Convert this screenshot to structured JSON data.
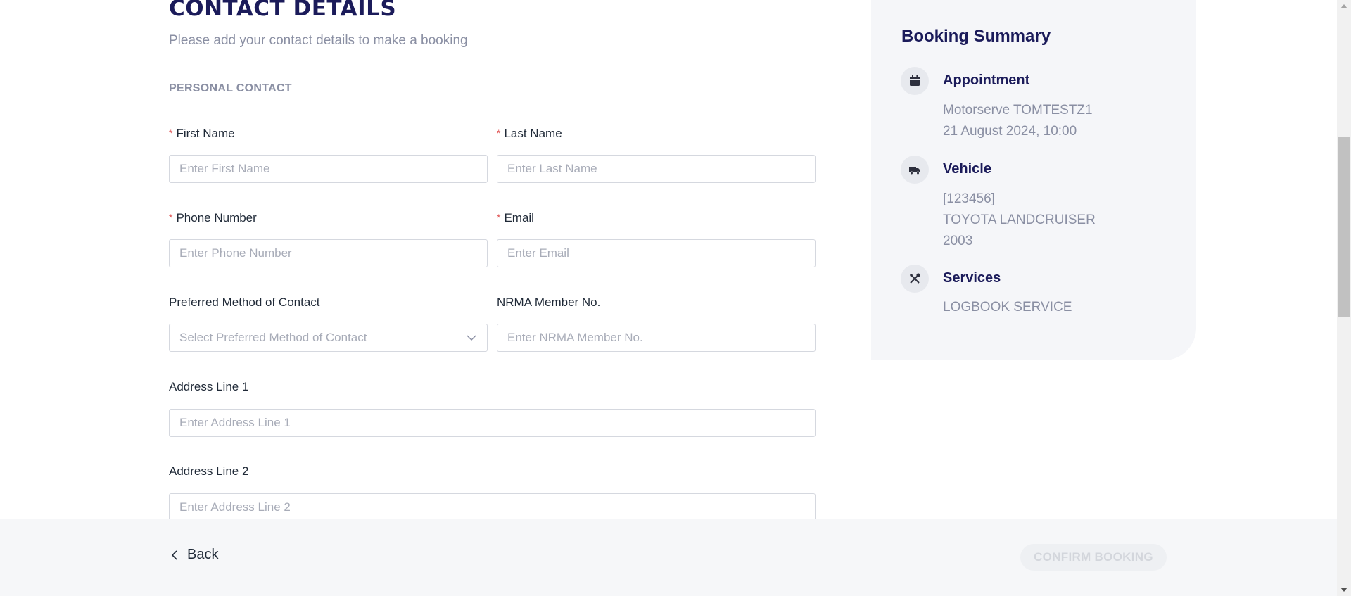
{
  "header": {
    "title": "CONTACT DETAILS",
    "subtitle": "Please add your contact details to make a booking"
  },
  "form": {
    "section_title": "PERSONAL CONTACT",
    "required_marker": "*",
    "first_name": {
      "label": "First Name",
      "placeholder": "Enter First Name",
      "value": ""
    },
    "last_name": {
      "label": "Last Name",
      "placeholder": "Enter Last Name",
      "value": ""
    },
    "phone": {
      "label": "Phone Number",
      "placeholder": "Enter Phone Number",
      "value": ""
    },
    "email": {
      "label": "Email",
      "placeholder": "Enter Email",
      "value": ""
    },
    "contact_method": {
      "label": "Preferred Method of Contact",
      "placeholder": "Select Preferred Method of Contact"
    },
    "nrma": {
      "label": "NRMA Member No.",
      "placeholder": "Enter NRMA Member No.",
      "value": ""
    },
    "address1": {
      "label": "Address Line 1",
      "placeholder": "Enter Address Line 1",
      "value": ""
    },
    "address2": {
      "label": "Address Line 2",
      "placeholder": "Enter Address Line 2",
      "value": ""
    }
  },
  "summary": {
    "title": "Booking Summary",
    "appointment": {
      "heading": "Appointment",
      "icon": "calendar-icon",
      "lines": [
        "Motorserve TOMTESTZ1",
        "21 August 2024, 10:00"
      ]
    },
    "vehicle": {
      "heading": "Vehicle",
      "icon": "truck-icon",
      "lines": [
        "[123456]",
        "TOYOTA LANDCRUISER",
        "2003"
      ]
    },
    "services": {
      "heading": "Services",
      "icon": "tools-icon",
      "lines": [
        "LOGBOOK SERVICE"
      ]
    }
  },
  "footer": {
    "back_label": "Back",
    "confirm_label": "CONFIRM BOOKING"
  },
  "colors": {
    "brand_navy": "#1b1b5a",
    "muted_text": "#8a8fa3",
    "required_red": "#e05252",
    "card_bg": "#f5f6f9",
    "button_disabled_bg": "#eef0f3"
  }
}
